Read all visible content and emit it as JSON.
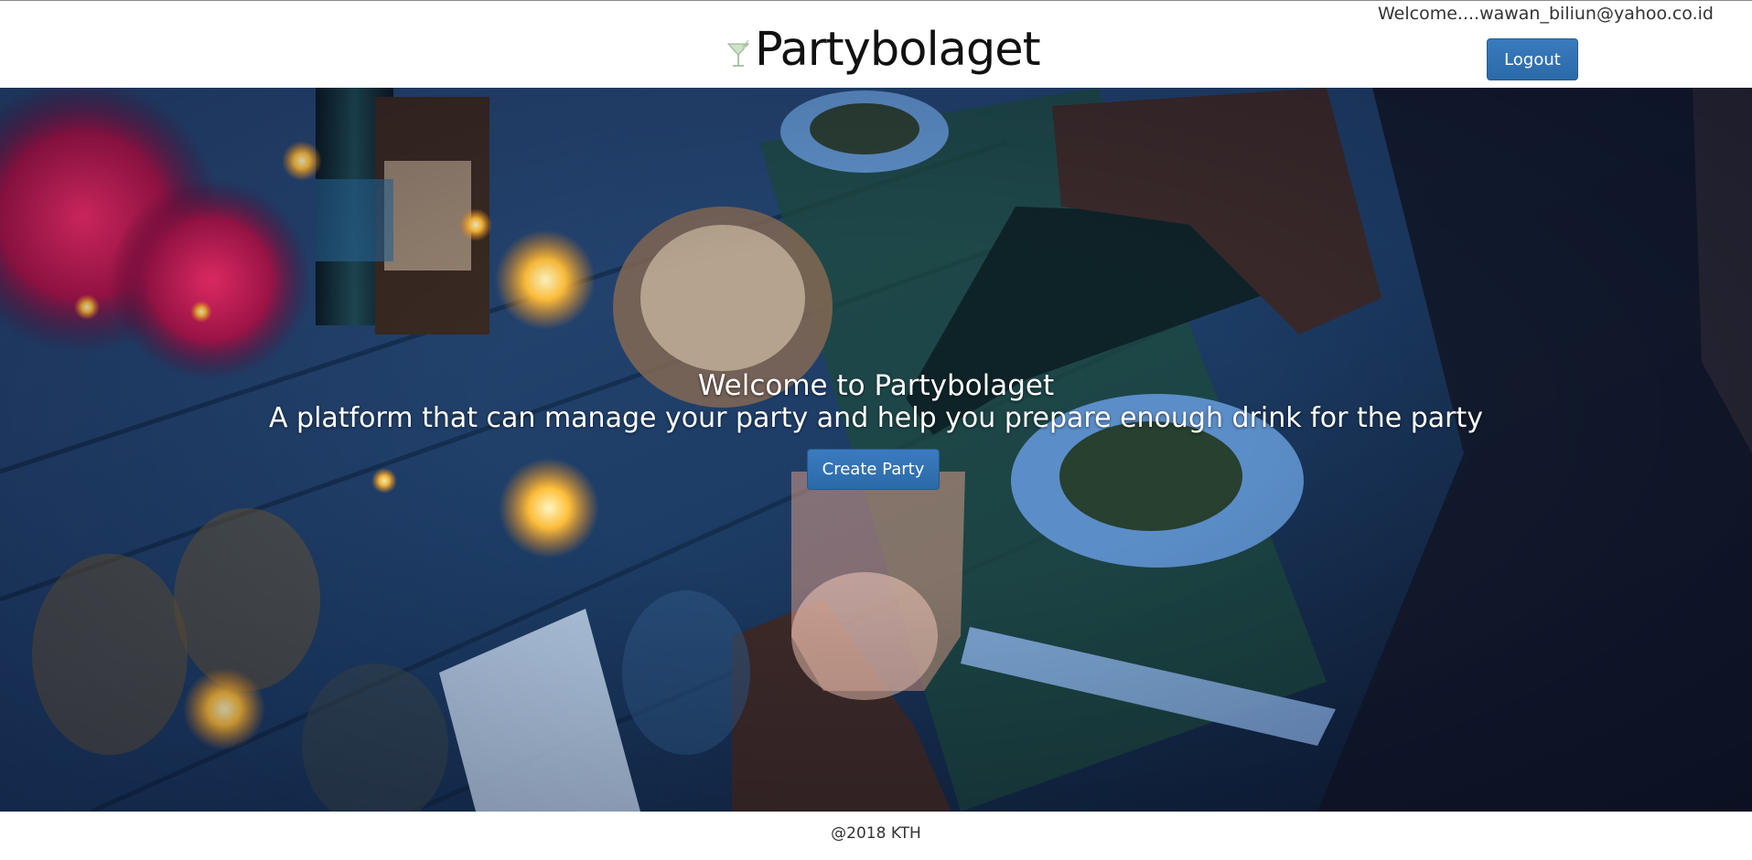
{
  "header": {
    "brand_name": "Partybolaget",
    "brand_icon": "cocktail-glass-icon",
    "welcome_text": "Welcome....wawan_biliun@yahoo.co.id",
    "logout_label": "Logout"
  },
  "hero": {
    "background": "party-table-photo",
    "title": "Welcome to Partybolaget",
    "subtitle": "A platform that can manage your party and help you prepare enough drink for the party",
    "create_label": "Create Party"
  },
  "footer": {
    "copyright": "@2018 KTH"
  },
  "colors": {
    "button_primary": "#2f6fae",
    "text_dark": "#111111"
  }
}
